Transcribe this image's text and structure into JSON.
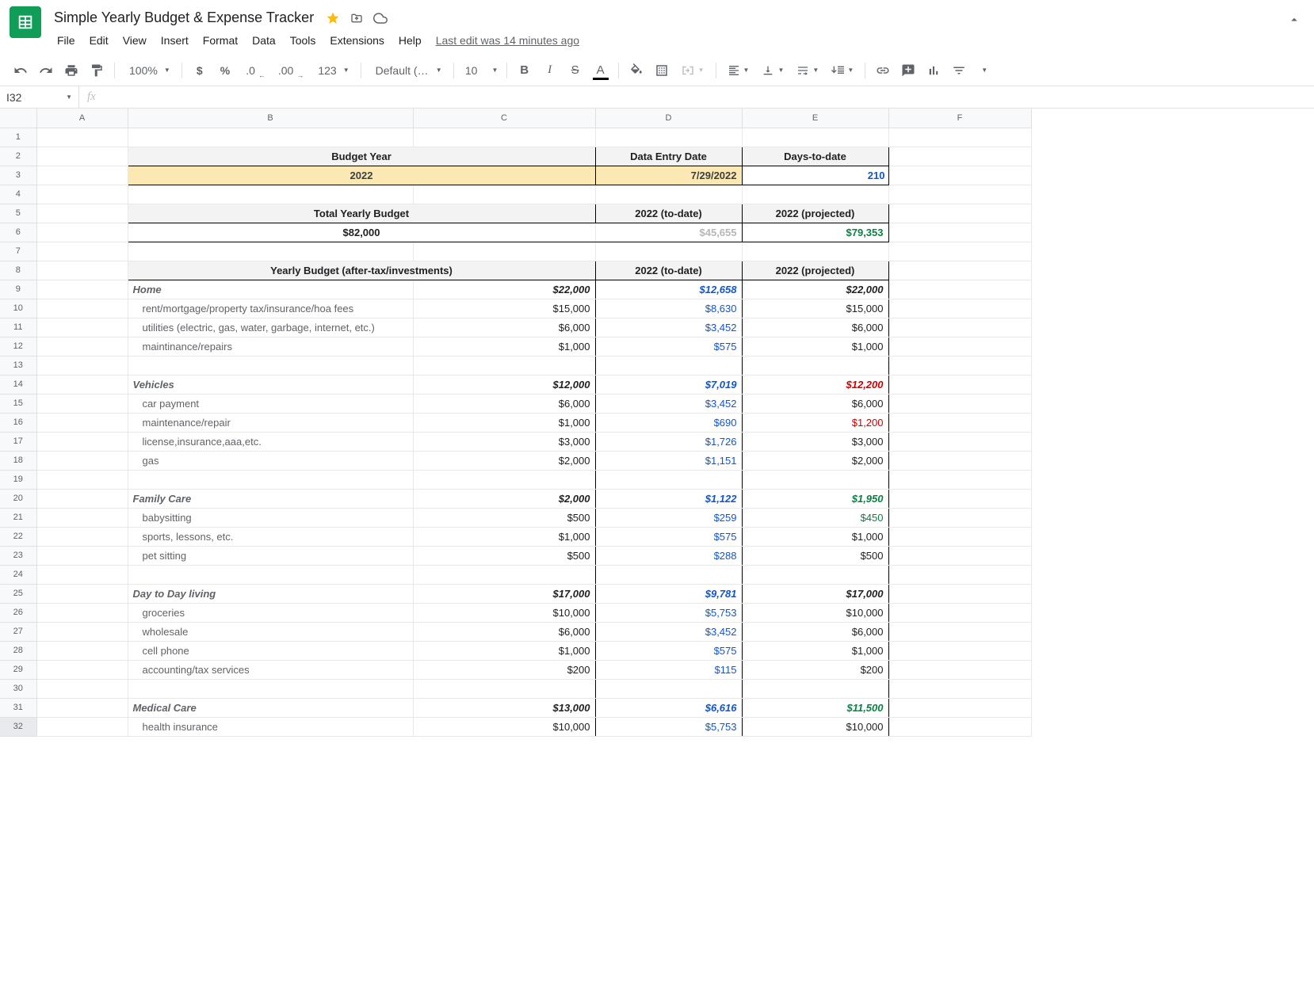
{
  "doc": {
    "title": "Simple Yearly Budget & Expense Tracker"
  },
  "menu": {
    "file": "File",
    "edit": "Edit",
    "view": "View",
    "insert": "Insert",
    "format": "Format",
    "data": "Data",
    "tools": "Tools",
    "extensions": "Extensions",
    "help": "Help",
    "last_edit": "Last edit was 14 minutes ago"
  },
  "toolbar": {
    "zoom": "100%",
    "currency": "$",
    "percent": "%",
    "dec_dec": ".0",
    "inc_dec": ".00",
    "fmt123": "123",
    "font": "Default (Ari...",
    "font_size": "10"
  },
  "namebox": {
    "cell": "I32"
  },
  "columns": [
    "A",
    "B",
    "C",
    "D",
    "E",
    "F"
  ],
  "sheet": {
    "r2": {
      "b": "Budget Year",
      "d": "Data Entry Date",
      "e": "Days-to-date"
    },
    "r3": {
      "b": "2022",
      "d": "7/29/2022",
      "e": "210"
    },
    "r5": {
      "b": "Total Yearly Budget",
      "d": "2022 (to-date)",
      "e": "2022 (projected)"
    },
    "r6": {
      "b": "$82,000",
      "d": "$45,655",
      "e": "$79,353"
    },
    "r8": {
      "b": "Yearly Budget (after-tax/investments)",
      "d": "2022 (to-date)",
      "e": "2022 (projected)"
    },
    "r9": {
      "b": "Home",
      "c": "$22,000",
      "d": "$12,658",
      "e": "$22,000"
    },
    "r10": {
      "b": "rent/mortgage/property tax/insurance/hoa fees",
      "c": "$15,000",
      "d": "$8,630",
      "e": "$15,000"
    },
    "r11": {
      "b": "utilities (electric, gas, water, garbage, internet, etc.)",
      "c": "$6,000",
      "d": "$3,452",
      "e": "$6,000"
    },
    "r12": {
      "b": "maintinance/repairs",
      "c": "$1,000",
      "d": "$575",
      "e": "$1,000"
    },
    "r14": {
      "b": "Vehicles",
      "c": "$12,000",
      "d": "$7,019",
      "e": "$12,200"
    },
    "r15": {
      "b": "car payment",
      "c": "$6,000",
      "d": "$3,452",
      "e": "$6,000"
    },
    "r16": {
      "b": "maintenance/repair",
      "c": "$1,000",
      "d": "$690",
      "e": "$1,200"
    },
    "r17": {
      "b": "license,insurance,aaa,etc.",
      "c": "$3,000",
      "d": "$1,726",
      "e": "$3,000"
    },
    "r18": {
      "b": "gas",
      "c": "$2,000",
      "d": "$1,151",
      "e": "$2,000"
    },
    "r20": {
      "b": "Family Care",
      "c": "$2,000",
      "d": "$1,122",
      "e": "$1,950"
    },
    "r21": {
      "b": "babysitting",
      "c": "$500",
      "d": "$259",
      "e": "$450"
    },
    "r22": {
      "b": "sports, lessons, etc.",
      "c": "$1,000",
      "d": "$575",
      "e": "$1,000"
    },
    "r23": {
      "b": "pet sitting",
      "c": "$500",
      "d": "$288",
      "e": "$500"
    },
    "r25": {
      "b": "Day to Day living",
      "c": "$17,000",
      "d": "$9,781",
      "e": "$17,000"
    },
    "r26": {
      "b": "groceries",
      "c": "$10,000",
      "d": "$5,753",
      "e": "$10,000"
    },
    "r27": {
      "b": "wholesale",
      "c": "$6,000",
      "d": "$3,452",
      "e": "$6,000"
    },
    "r28": {
      "b": "cell phone",
      "c": "$1,000",
      "d": "$575",
      "e": "$1,000"
    },
    "r29": {
      "b": "accounting/tax services",
      "c": "$200",
      "d": "$115",
      "e": "$200"
    },
    "r31": {
      "b": "Medical Care",
      "c": "$13,000",
      "d": "$6,616",
      "e": "$11,500"
    },
    "r32": {
      "b": "health insurance",
      "c": "$10,000",
      "d": "$5,753",
      "e": "$10,000"
    }
  }
}
